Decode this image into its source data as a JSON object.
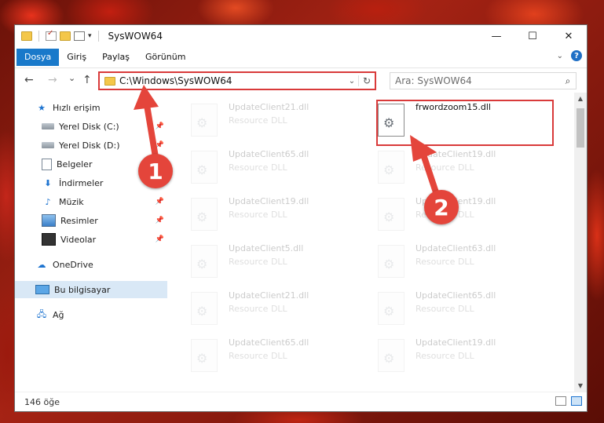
{
  "window": {
    "title": "SysWOW64",
    "controls": {
      "minimize": "—",
      "maximize": "☐",
      "close": "✕"
    }
  },
  "ribbon": {
    "tabs": [
      {
        "label": "Dosya",
        "active": true
      },
      {
        "label": "Giriş",
        "active": false
      },
      {
        "label": "Paylaş",
        "active": false
      },
      {
        "label": "Görünüm",
        "active": false
      }
    ],
    "help": "?"
  },
  "nav": {
    "back": "←",
    "forward": "→",
    "recent": "⌄",
    "up": "↑",
    "address": "C:\\Windows\\SysWOW64",
    "search_placeholder": "Ara: SysWOW64"
  },
  "sidebar": {
    "items": [
      {
        "label": "Hızlı erişim",
        "icon": "star-icon",
        "pinned": false
      },
      {
        "label": "Yerel Disk (C:)",
        "icon": "drive-icon",
        "pinned": true
      },
      {
        "label": "Yerel Disk (D:)",
        "icon": "drive-icon",
        "pinned": true
      },
      {
        "label": "Belgeler",
        "icon": "documents-icon",
        "pinned": true
      },
      {
        "label": "İndirmeler",
        "icon": "downloads-icon",
        "pinned": true
      },
      {
        "label": "Müzik",
        "icon": "music-icon",
        "pinned": true
      },
      {
        "label": "Resimler",
        "icon": "pictures-icon",
        "pinned": true
      },
      {
        "label": "Videolar",
        "icon": "videos-icon",
        "pinned": true
      },
      {
        "label": "OneDrive",
        "icon": "onedrive-icon",
        "pinned": false
      },
      {
        "label": "Bu bilgisayar",
        "icon": "this-pc-icon",
        "pinned": false,
        "selected": true
      },
      {
        "label": "Ağ",
        "icon": "network-icon",
        "pinned": false
      }
    ]
  },
  "files": {
    "left": [
      {
        "name": "UpdateClient21.dll",
        "type": "Resource DLL"
      },
      {
        "name": "UpdateClient65.dll",
        "type": "Resource DLL"
      },
      {
        "name": "UpdateClient19.dll",
        "type": "Resource DLL"
      },
      {
        "name": "UpdateClient5.dll",
        "type": "Resource DLL"
      },
      {
        "name": "UpdateClient21.dll",
        "type": "Resource DLL"
      },
      {
        "name": "UpdateClient65.dll",
        "type": "Resource DLL"
      }
    ],
    "right": [
      {
        "name": "frwordzoom15.dll",
        "type": ""
      },
      {
        "name": "UpdateClient19.dll",
        "type": "Resource DLL"
      },
      {
        "name": "UpdateClient19.dll",
        "type": "Resource DLL"
      },
      {
        "name": "UpdateClient63.dll",
        "type": "Resource DLL"
      },
      {
        "name": "UpdateClient65.dll",
        "type": "Resource DLL"
      },
      {
        "name": "UpdateClient19.dll",
        "type": "Resource DLL"
      }
    ]
  },
  "status": {
    "item_count": "146 öğe"
  },
  "annotations": {
    "step1": "1",
    "step2": "2",
    "color": "#d93a3a"
  }
}
